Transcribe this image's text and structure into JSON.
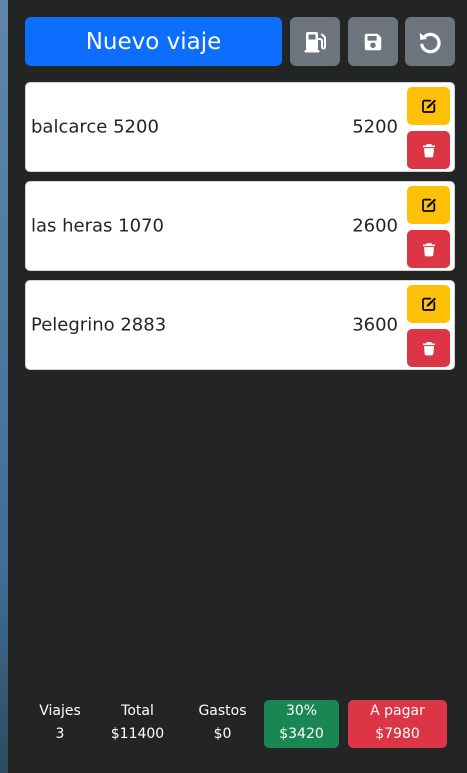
{
  "toolbar": {
    "new_trip_label": "Nuevo viaje",
    "fuel_icon": "gas-pump-icon",
    "save_icon": "floppy-disk-icon",
    "reset_icon": "rotate-left-icon"
  },
  "trips": [
    {
      "name": "balcarce 5200",
      "amount": "5200"
    },
    {
      "name": "las heras 1070",
      "amount": "2600"
    },
    {
      "name": "Pelegrino 2883",
      "amount": "3600"
    }
  ],
  "summary": {
    "viajes": {
      "label": "Viajes",
      "value": "3"
    },
    "total": {
      "label": "Total",
      "value": "$11400"
    },
    "gastos": {
      "label": "Gastos",
      "value": "$0"
    },
    "percent": {
      "label": "30%",
      "value": "$3420"
    },
    "a_pagar": {
      "label": "A pagar",
      "value": "$7980"
    }
  },
  "colors": {
    "primary": "#0d6efd",
    "secondary": "#6c757d",
    "warning": "#ffc107",
    "danger": "#dc3545",
    "success": "#198754",
    "background": "#232424"
  }
}
